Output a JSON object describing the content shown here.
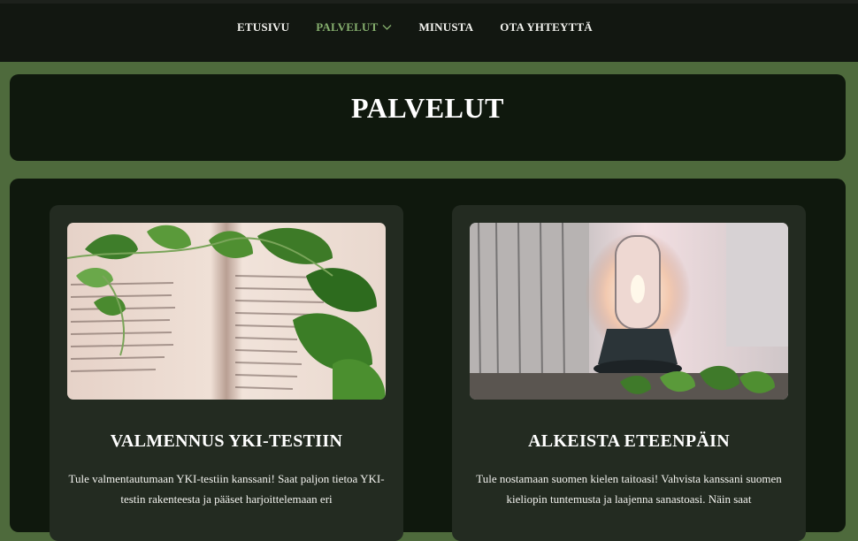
{
  "nav": {
    "items": [
      {
        "label": "ETUSIVU"
      },
      {
        "label": "PALVELUT",
        "active": true,
        "icon": "chevron-down-icon"
      },
      {
        "label": "MINUSTA"
      },
      {
        "label": "OTA YHTEYTTÄ"
      }
    ],
    "active_color": "#86b06e"
  },
  "page": {
    "title": "PALVELUT"
  },
  "services": [
    {
      "title": "VALMENNUS YKI-TESTIIN",
      "text": "Tule valmentautumaan YKI-testiin kanssani! Saat paljon tietoa YKI-testin rakenteesta ja pääset harjoittelemaan eri",
      "image": "open-book-with-ivy-photo"
    },
    {
      "title": "ALKEISTA ETEENPÄIN",
      "text": "Tule nostamaan suomen kielen taitoasi! Vahvista kanssani suomen kieliopin tuntemusta ja laajenna sanastoasi. Näin saat",
      "image": "lantern-and-ivy-photo"
    }
  ],
  "colors": {
    "background": "#4e6a3c",
    "topbar": "#121711",
    "card": "#0f180d",
    "service_card": "#232b21"
  }
}
